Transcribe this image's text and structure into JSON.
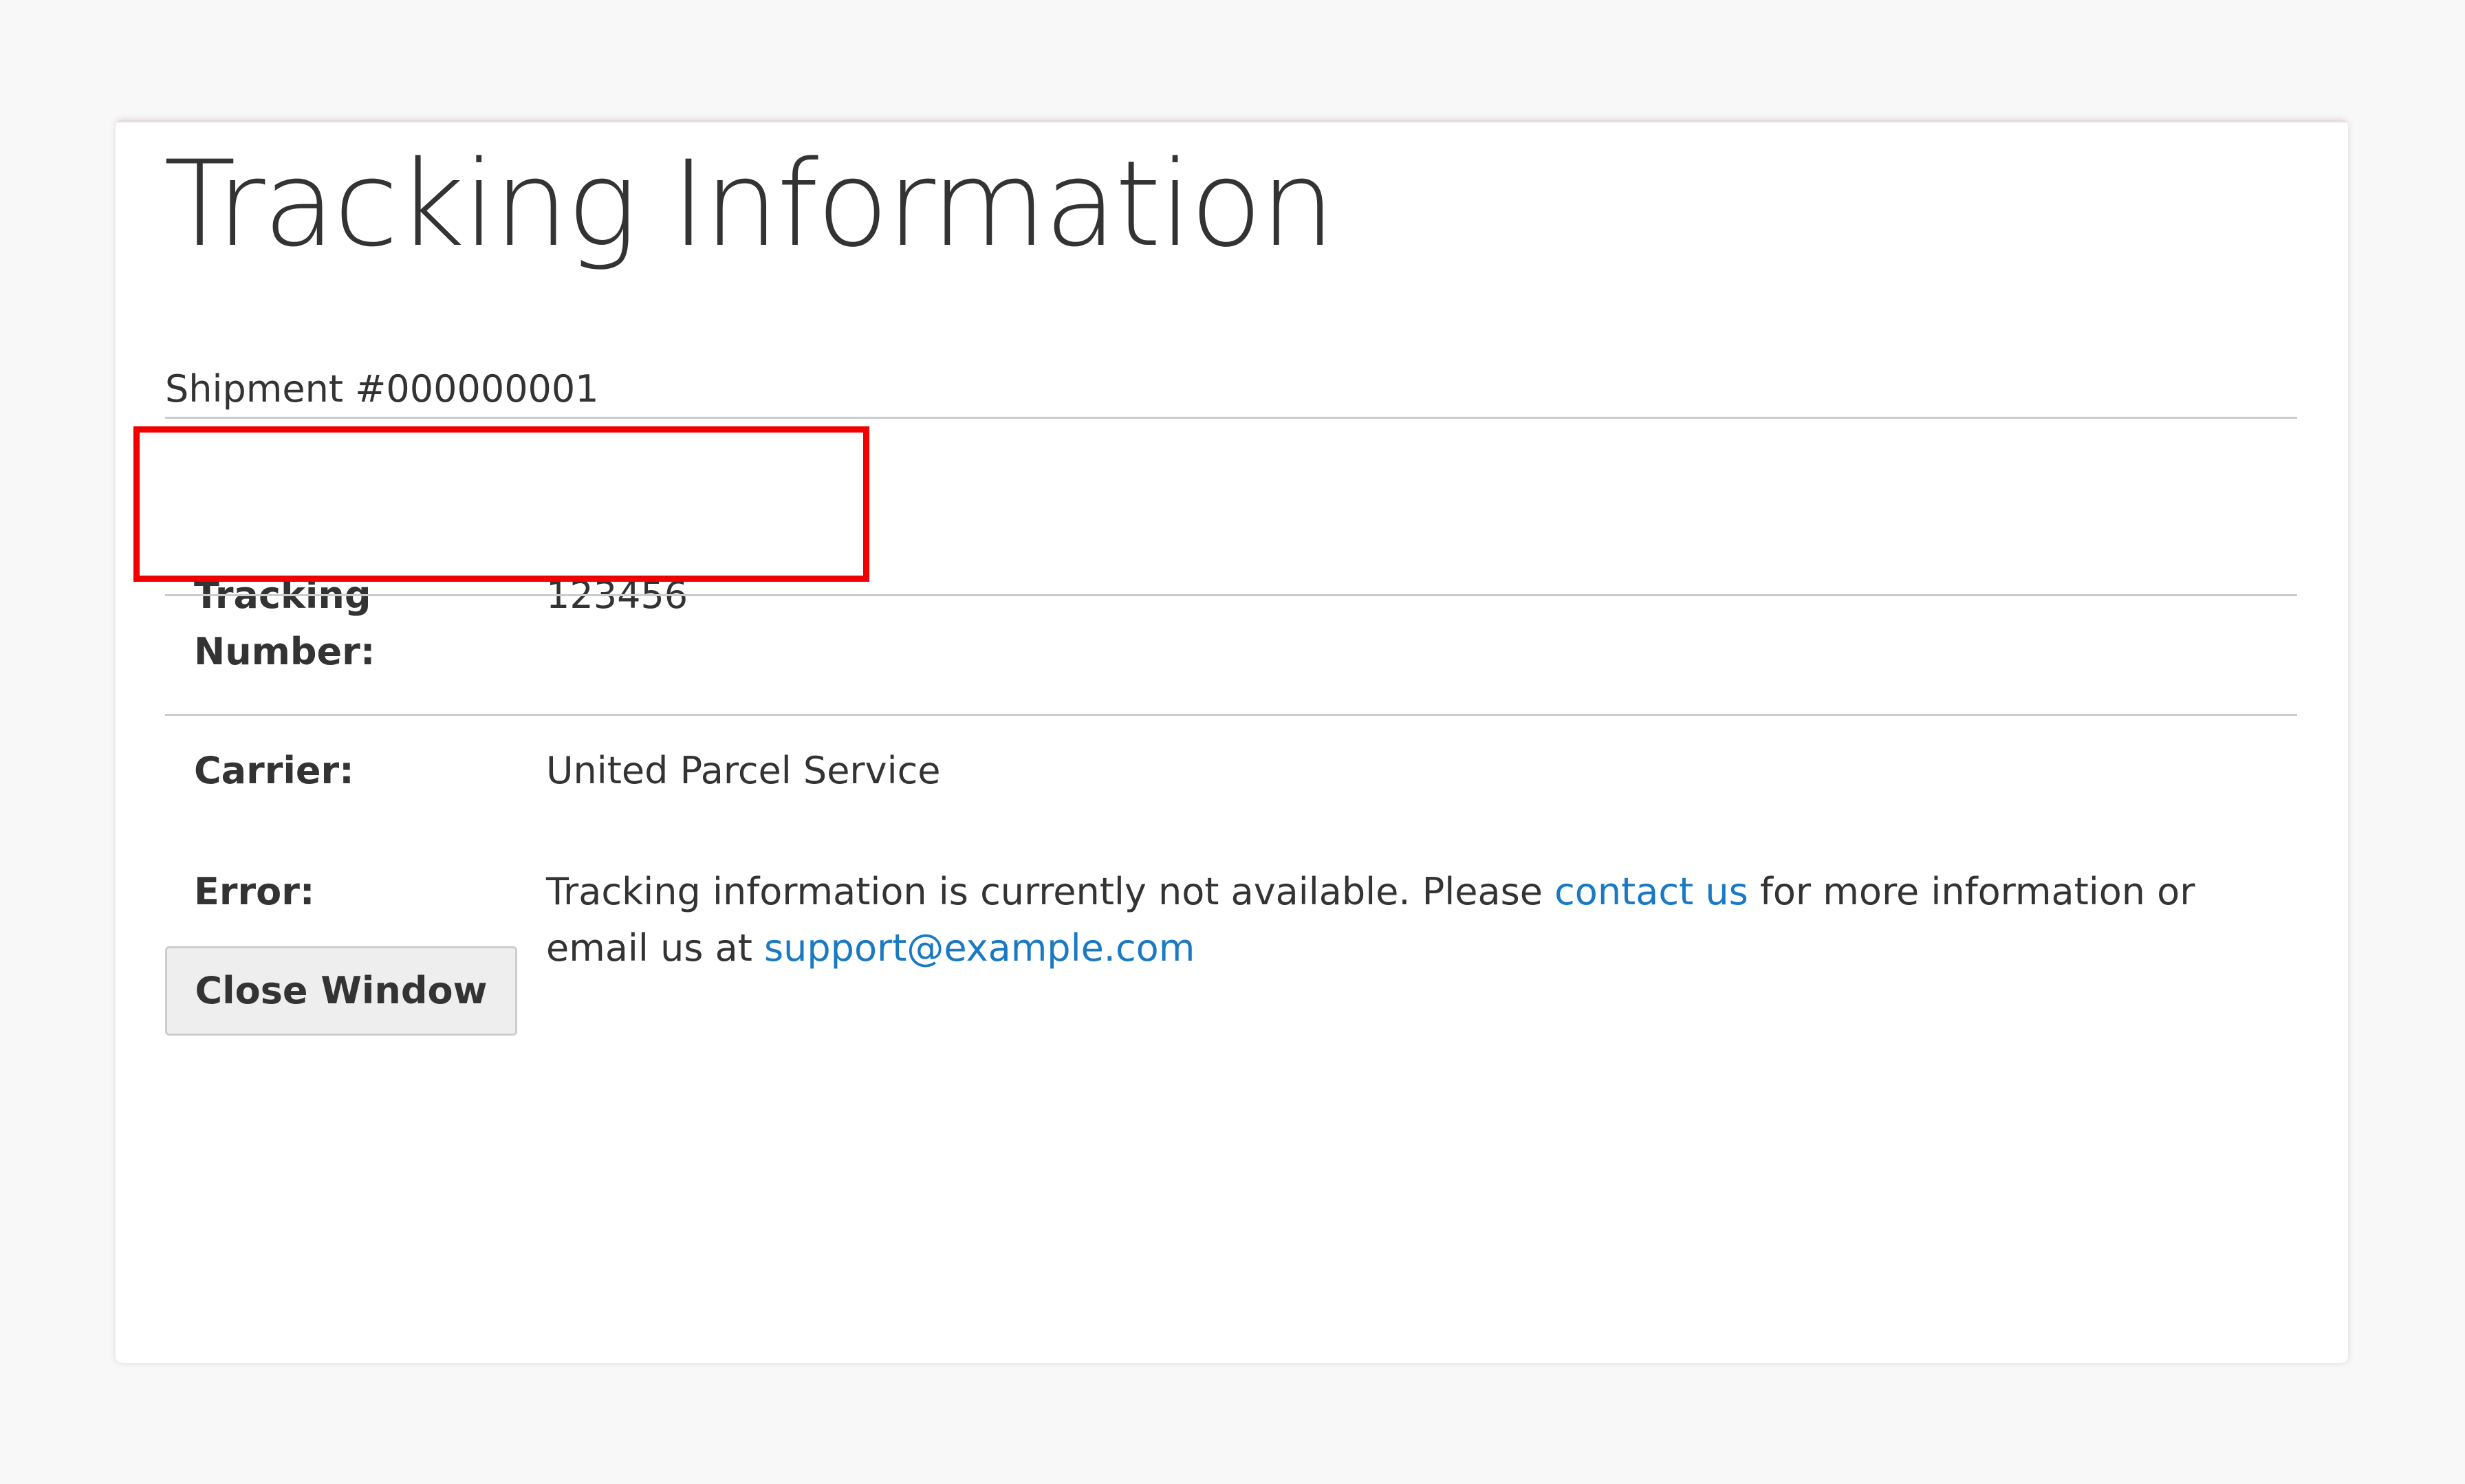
{
  "page": {
    "title": "Tracking Information",
    "shipment_title": "Shipment #000000001"
  },
  "tracking": {
    "number_label": "Tracking Number:",
    "number_value": "123456",
    "carrier_label": "Carrier:",
    "carrier_value": "United Parcel Service",
    "error_label": "Error:",
    "error_text_before": "Tracking information is currently not available. Please ",
    "contact_link": "contact us",
    "error_text_middle": " for more information or email us at ",
    "support_email": "support@example.com"
  },
  "actions": {
    "close_window_label": "Close Window"
  },
  "colors": {
    "page_background": "#f8f8f8",
    "text": "#333333",
    "link": "#1979c3",
    "highlight": "#f00000",
    "button_background": "#eeeeee"
  }
}
